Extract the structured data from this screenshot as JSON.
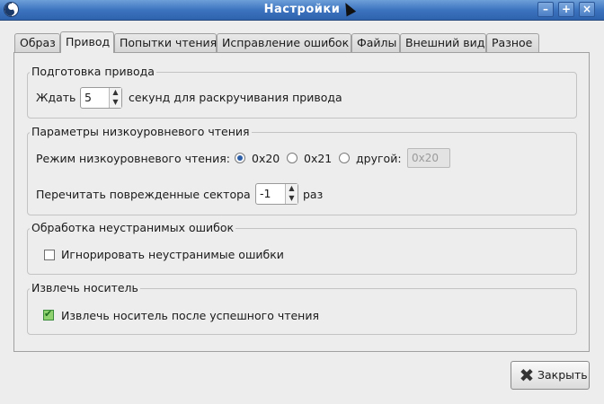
{
  "window": {
    "title": "Настройки",
    "buttons": {
      "minimize": "–",
      "maximize": "+",
      "close": "×"
    }
  },
  "tabs": [
    {
      "label": "Образ",
      "active": false
    },
    {
      "label": "Привод",
      "active": true
    },
    {
      "label": "Попытки чтения",
      "active": false
    },
    {
      "label": "Исправление ошибок",
      "active": false
    },
    {
      "label": "Файлы",
      "active": false
    },
    {
      "label": "Внешний вид",
      "active": false
    },
    {
      "label": "Разное",
      "active": false
    }
  ],
  "drive_prep": {
    "title": "Подготовка привода",
    "wait_label": "Ждать",
    "wait_value": "5",
    "wait_suffix": "секунд для раскручивания привода"
  },
  "lowlevel": {
    "title": "Параметры низкоуровневого чтения",
    "mode_label": "Режим низкоуровневого чтения:",
    "option_0x20": "0x20",
    "option_0x21": "0x21",
    "option_other": "другой:",
    "other_value": "0x20",
    "selected": "0x20",
    "reread_label": "Перечитать поврежденные сектора",
    "reread_value": "-1",
    "reread_suffix": "раз"
  },
  "unrecoverable": {
    "title": "Обработка неустранимых ошибок",
    "ignore_label": "Игнорировать неустранимые ошибки",
    "ignore_checked": false
  },
  "eject": {
    "title": "Извлечь носитель",
    "eject_label": "Извлечь носитель после успешного чтения",
    "eject_checked": true
  },
  "footer": {
    "close_label": "Закрыть"
  },
  "icons": {
    "app": "yin-yang-icon",
    "close": "close-icon",
    "spin_up": "▲",
    "spin_down": "▼"
  },
  "colors": {
    "titlebar": "#3d74bf",
    "radio_on": "#2b5ea6",
    "check_on": "#8fd16f"
  }
}
